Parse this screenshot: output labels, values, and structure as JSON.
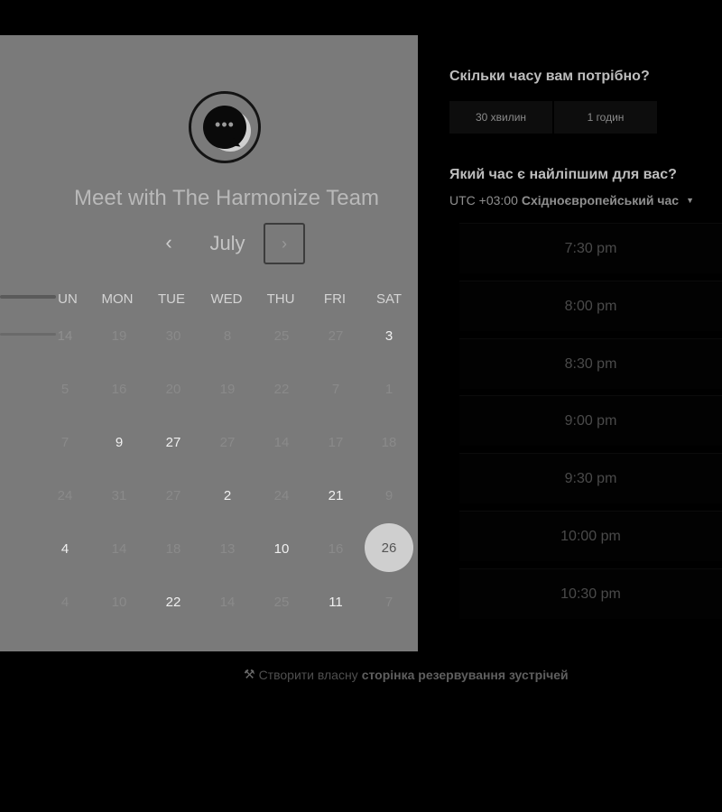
{
  "header": {
    "title": "Meet with The Harmonize Team",
    "month": "July",
    "prev_icon": "‹",
    "next_icon": "›"
  },
  "calendar": {
    "weekdays": [
      "UN",
      "MON",
      "TUE",
      "WED",
      "THU",
      "FRI",
      "SAT"
    ],
    "rows": [
      [
        "14",
        "19",
        "30",
        "8",
        "25",
        "27",
        "3"
      ],
      [
        "5",
        "16",
        "20",
        "19",
        "22",
        "7",
        "1"
      ],
      [
        "7",
        "9",
        "27",
        "27",
        "14",
        "17",
        "18"
      ],
      [
        "24",
        "31",
        "27",
        "2",
        "24",
        "21",
        "9"
      ],
      [
        "4",
        "14",
        "18",
        "13",
        "10",
        "16",
        "26"
      ],
      [
        "4",
        "10",
        "22",
        "14",
        "25",
        "11",
        "7"
      ]
    ],
    "selected": "26"
  },
  "duration": {
    "question": "Скільки часу вам потрібно?",
    "options": [
      "30 хвилин",
      "1 годин"
    ]
  },
  "time": {
    "question": "Який час є найліпшим для вас?",
    "tz_offset": "UTC +03:00",
    "tz_name": "Східноєвропейський час",
    "slots": [
      "7:30 pm",
      "8:00 pm",
      "8:30 pm",
      "9:00 pm",
      "9:30 pm",
      "10:00 pm",
      "10:30 pm"
    ]
  },
  "footer": {
    "prefix": "Створити власну",
    "link": "сторінка резервування зустрічей"
  },
  "colors": {
    "background": "#000000",
    "calendar_panel": "#7a7a7a",
    "selected_day": "#cfcfcf"
  }
}
